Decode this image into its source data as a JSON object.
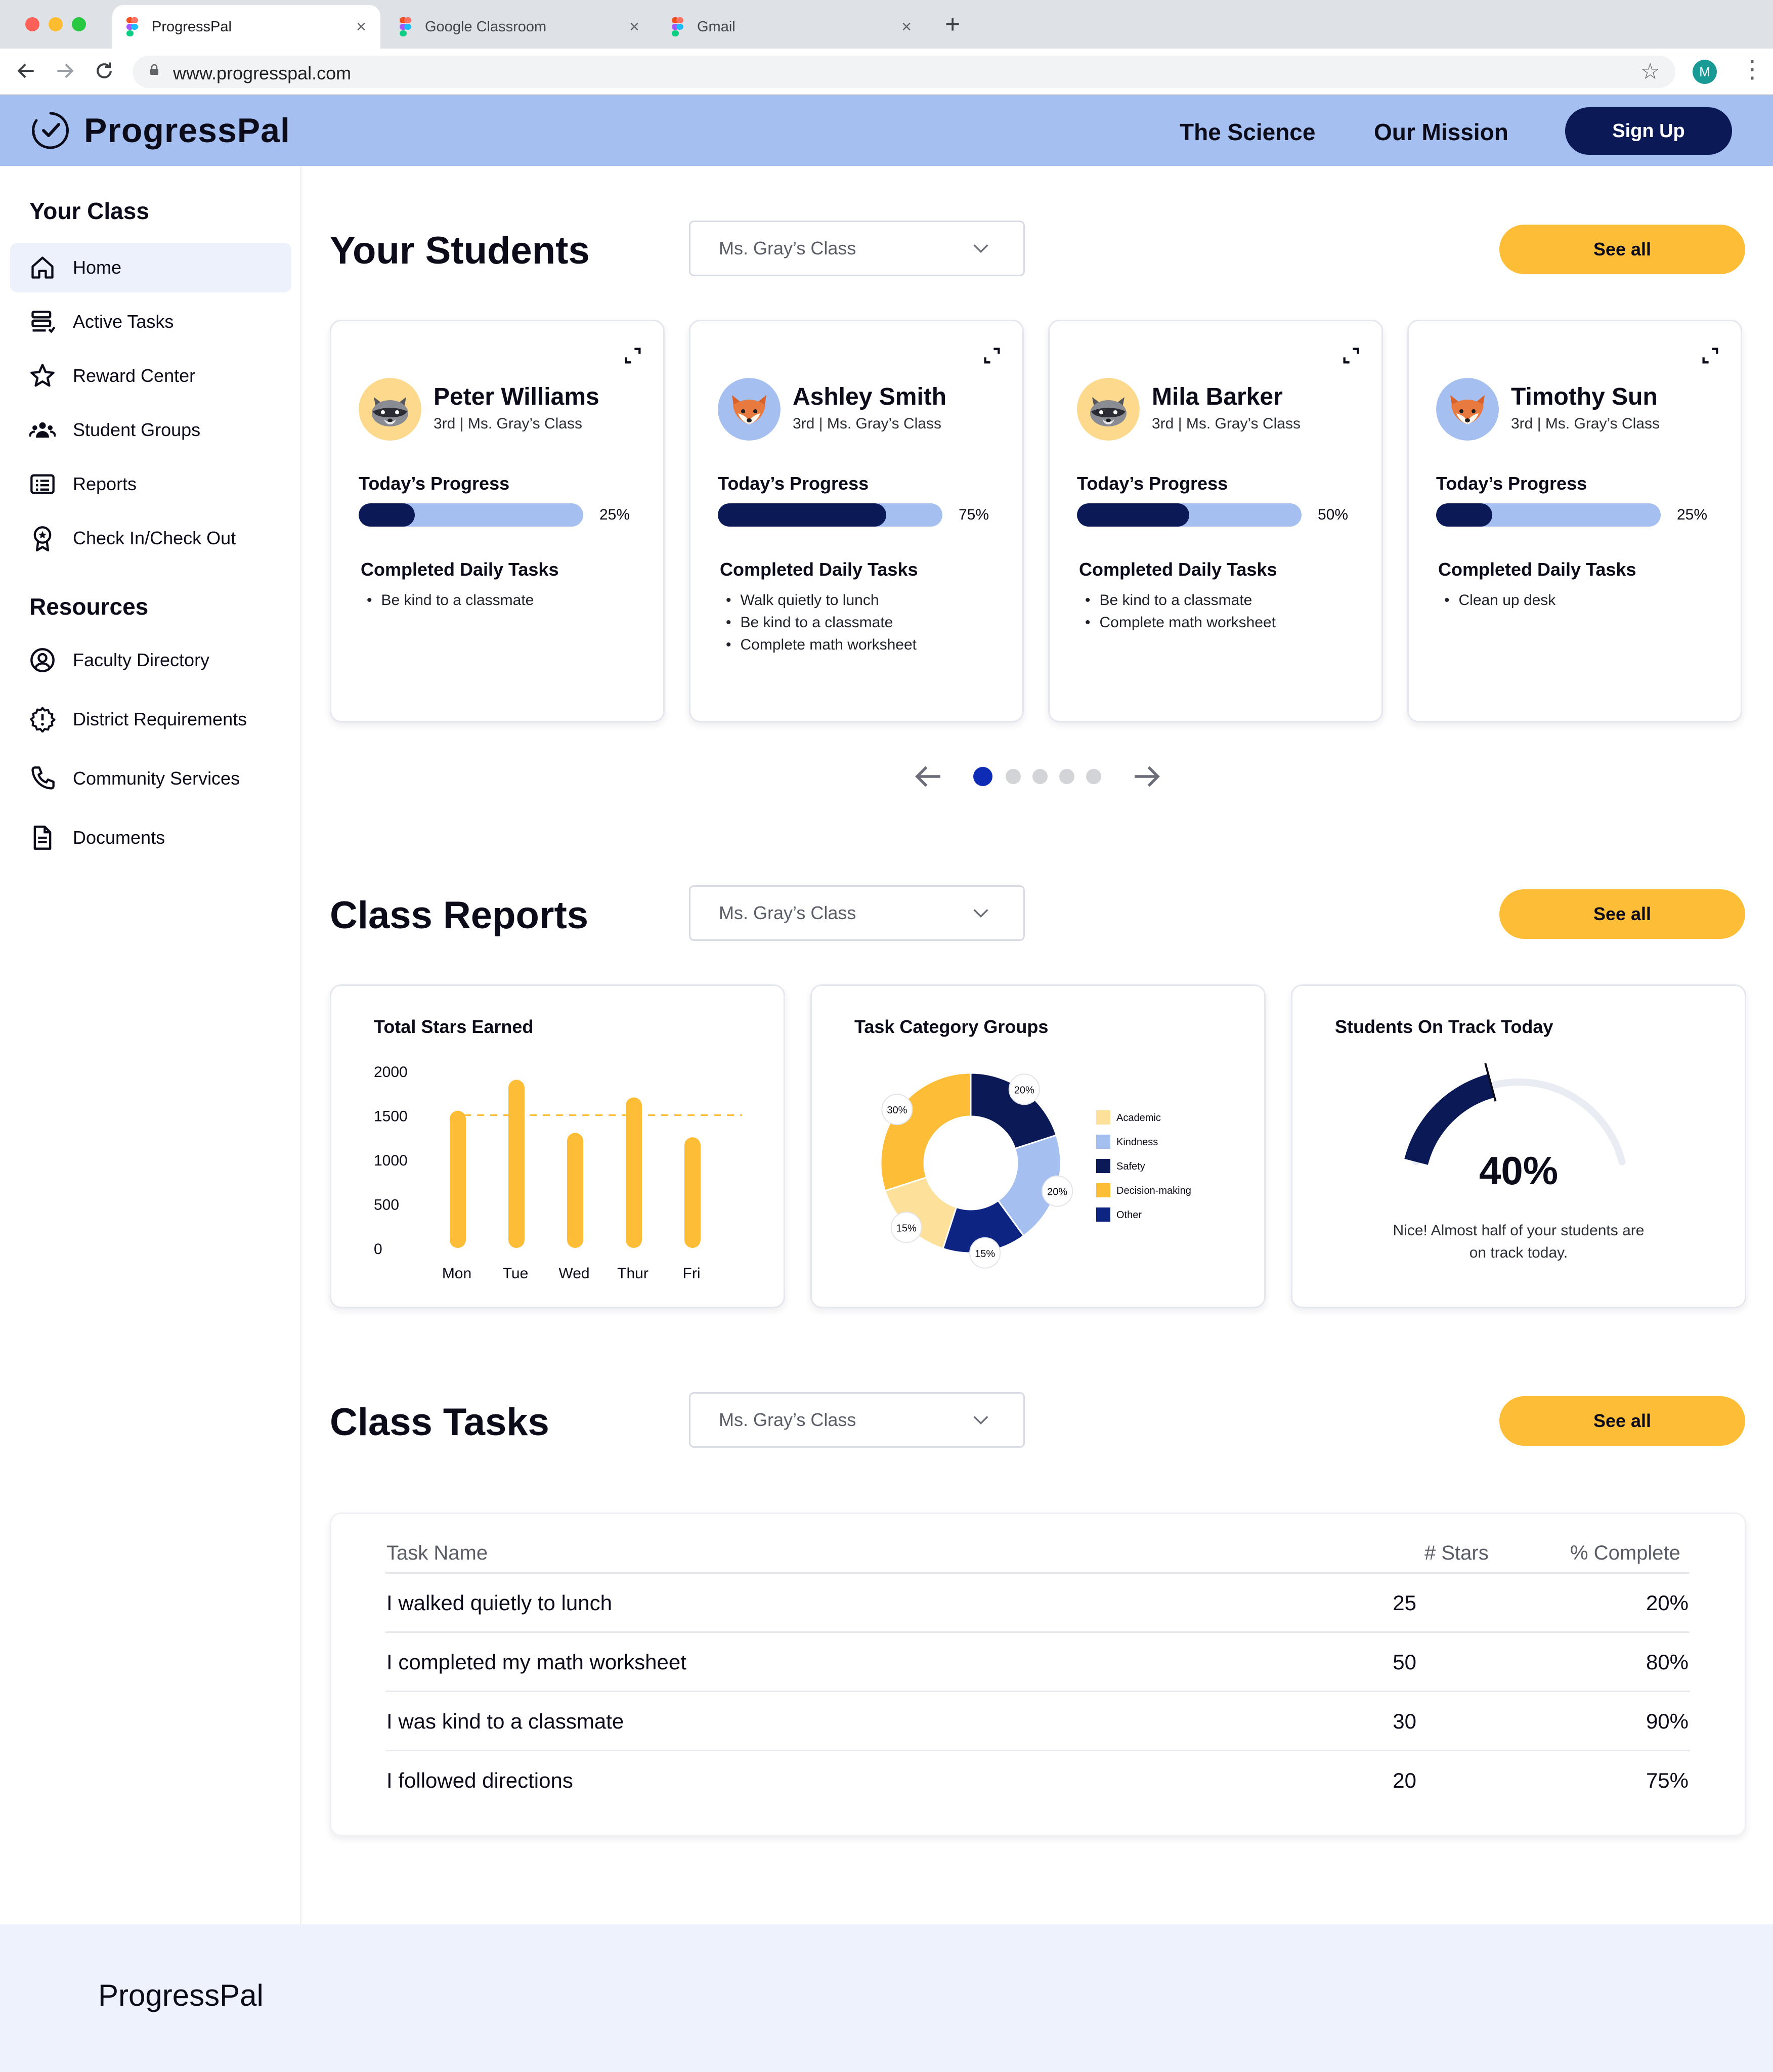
{
  "browser": {
    "tabs": [
      {
        "title": "ProgressPal",
        "close": "×",
        "active": true
      },
      {
        "title": "Google Classroom",
        "close": "×",
        "active": false
      },
      {
        "title": "Gmail",
        "close": "×",
        "active": false
      }
    ],
    "new_tab": "+",
    "url": "www.progresspal.com",
    "profile_initial": "M",
    "nav_icons": [
      "back-arrow-icon",
      "forward-arrow-icon",
      "reload-icon",
      "lock-icon",
      "bookmark-star-icon",
      "kebab-menu-icon"
    ]
  },
  "header": {
    "brand": "ProgressPal",
    "nav": [
      "The Science",
      "Our Mission"
    ],
    "signup": "Sign Up",
    "colors": {
      "header_bg": "#a4bff0",
      "navy": "#0b1a56",
      "accent_yellow": "#fdbd36"
    }
  },
  "sidebar": {
    "class_heading": "Your Class",
    "class_items": [
      {
        "label": "Home",
        "icon": "home-icon",
        "active": true
      },
      {
        "label": "Active Tasks",
        "icon": "tasks-icon"
      },
      {
        "label": "Reward Center",
        "icon": "star-icon"
      },
      {
        "label": "Student Groups",
        "icon": "group-icon"
      },
      {
        "label": "Reports",
        "icon": "report-icon"
      },
      {
        "label": "Check In/Check Out",
        "icon": "badge-icon"
      }
    ],
    "resources_heading": "Resources",
    "resource_items": [
      {
        "label": "Faculty Directory",
        "icon": "person-circle-icon"
      },
      {
        "label": "District Requirements",
        "icon": "gear-alert-icon"
      },
      {
        "label": "Community Services",
        "icon": "phone-icon"
      },
      {
        "label": "Documents",
        "icon": "document-icon"
      }
    ]
  },
  "students_section": {
    "title": "Your Students",
    "class_select": "Ms. Gray’s Class",
    "see_all": "See all",
    "students": [
      {
        "name": "Peter Williams",
        "sub": "3rd  | Ms. Gray’s Class",
        "avatar": "raccoon",
        "progress_label": "Today’s Progress",
        "progress": 25,
        "progress_text": "25%",
        "tasks_title": "Completed Daily Tasks",
        "tasks": [
          "Be kind to a classmate"
        ]
      },
      {
        "name": "Ashley Smith",
        "sub": "3rd  | Ms. Gray’s Class",
        "avatar": "fox",
        "progress_label": "Today’s Progress",
        "progress": 75,
        "progress_text": "75%",
        "tasks_title": "Completed Daily Tasks",
        "tasks": [
          "Walk quietly to lunch",
          "Be kind to a classmate",
          "Complete math worksheet"
        ]
      },
      {
        "name": "Mila Barker",
        "sub": "3rd  | Ms. Gray’s Class",
        "avatar": "raccoon",
        "progress_label": "Today’s Progress",
        "progress": 50,
        "progress_text": "50%",
        "tasks_title": "Completed Daily Tasks",
        "tasks": [
          "Be kind to a classmate",
          "Complete math worksheet"
        ]
      },
      {
        "name": "Timothy Sun",
        "sub": "3rd  | Ms. Gray’s Class",
        "avatar": "fox",
        "progress_label": "Today’s Progress",
        "progress": 25,
        "progress_text": "25%",
        "tasks_title": "Completed Daily Tasks",
        "tasks": [
          "Clean up desk"
        ]
      }
    ],
    "pager": {
      "pages": 5,
      "current": 1
    }
  },
  "reports_section": {
    "title": "Class Reports",
    "class_select": "Ms. Gray’s Class",
    "see_all": "See all",
    "stars_card_title": "Total Stars Earned",
    "categories_card_title": "Task Category Groups",
    "on_track_card_title": "Students On Track Today",
    "on_track_value": "40%",
    "on_track_caption_1": "Nice! Almost half of your students are",
    "on_track_caption_2": "on track today."
  },
  "chart_data": [
    {
      "type": "bar",
      "title": "Total Stars Earned",
      "categories": [
        "Mon",
        "Tue",
        "Wed",
        "Thur",
        "Fri"
      ],
      "values": [
        1550,
        1900,
        1300,
        1700,
        1250
      ],
      "ylim": [
        0,
        2000
      ],
      "yticks": [
        0,
        500,
        1000,
        1500,
        2000
      ],
      "average_line": 1500,
      "color": "#fdbd36"
    },
    {
      "type": "pie",
      "title": "Task Category Groups",
      "labels": [
        "Academic",
        "Kindness",
        "Safety",
        "Decision-making",
        "Other"
      ],
      "legend_order": [
        "Academic",
        "Kindness",
        "Safety",
        "Decision-making",
        "Other"
      ],
      "legend_colors": [
        "#fde09a",
        "#a4bff0",
        "#0b1a56",
        "#fdbd36",
        "#0d2483"
      ],
      "slices": [
        {
          "label": "Safety",
          "value": 20,
          "text": "20%",
          "color": "#0b1a56"
        },
        {
          "label": "Kindness",
          "value": 20,
          "text": "20%",
          "color": "#a4bff0"
        },
        {
          "label": "Other",
          "value": 15,
          "text": "15%",
          "color": "#0d2483"
        },
        {
          "label": "Academic",
          "value": 15,
          "text": "15%",
          "color": "#fde09a"
        },
        {
          "label": "Decision-making",
          "value": 30,
          "text": "30%",
          "color": "#fdbd36"
        }
      ]
    },
    {
      "type": "gauge",
      "title": "Students On Track Today",
      "value": 40,
      "max": 100
    }
  ],
  "tasks_section": {
    "title": "Class Tasks",
    "class_select": "Ms. Gray’s Class",
    "see_all": "See all",
    "columns": [
      "Task Name",
      "# Stars",
      "% Complete"
    ],
    "rows": [
      {
        "task": "I walked quietly to lunch",
        "stars": "25",
        "complete": "20%"
      },
      {
        "task": "I completed my math worksheet",
        "stars": "50",
        "complete": "80%"
      },
      {
        "task": "I was kind to a classmate",
        "stars": "30",
        "complete": "90%"
      },
      {
        "task": "I followed directions",
        "stars": "20",
        "complete": "75%"
      }
    ]
  },
  "footer": {
    "brand": "ProgressPal"
  }
}
